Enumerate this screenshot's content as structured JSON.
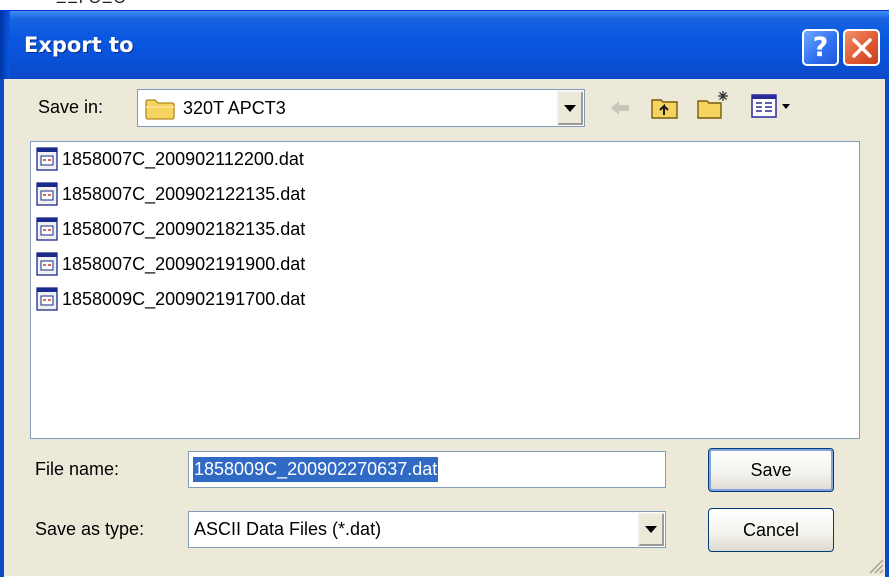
{
  "background": {
    "partial_text": "ΞΞΓΟΞΟ"
  },
  "dialog": {
    "title": "Export to",
    "help_label": "?"
  },
  "save_in": {
    "label": "Save in:",
    "value": "320T APCT3"
  },
  "toolbar": {
    "icons": [
      "back-arrow-icon",
      "up-one-level-icon",
      "create-new-folder-icon",
      "view-menu-icon"
    ]
  },
  "files": [
    "1858007C_200902112200.dat",
    "1858007C_200902122135.dat",
    "1858007C_200902182135.dat",
    "1858007C_200902191900.dat",
    "1858009C_200902191700.dat"
  ],
  "file_name": {
    "label": "File name:",
    "value": "1858009C_200902270637.dat"
  },
  "save_as_type": {
    "label": "Save as type:",
    "value": "ASCII Data Files (*.dat)"
  },
  "buttons": {
    "save": "Save",
    "cancel": "Cancel"
  },
  "colors": {
    "titlebar": "#0a57e0",
    "dialog_bg": "#ece9d8",
    "selection": "#316ac5",
    "close_button": "#e25a33"
  }
}
